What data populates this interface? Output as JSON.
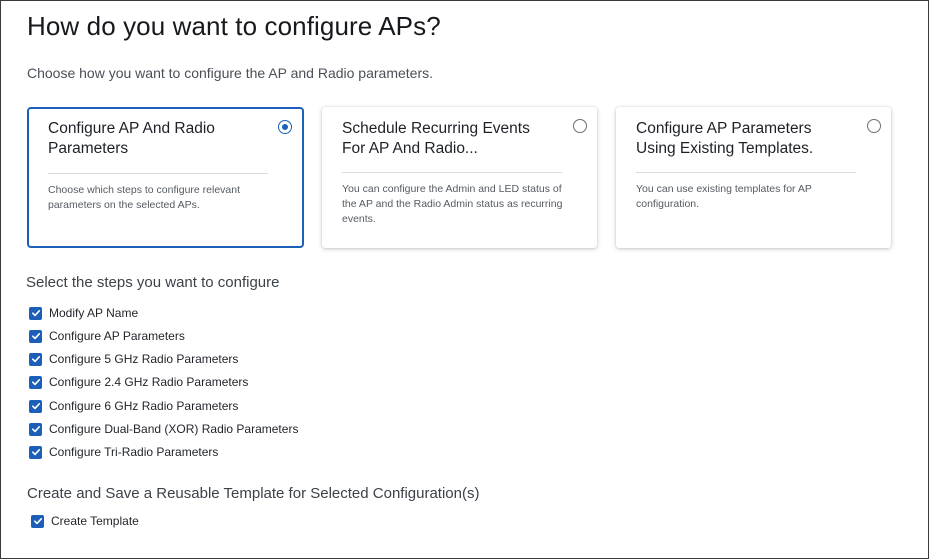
{
  "header": {
    "title": "How do you want to configure APs?",
    "subtitle": "Choose how you want to configure the AP and Radio parameters."
  },
  "options": [
    {
      "title": "Configure AP And Radio Parameters",
      "description": "Choose which steps to configure relevant parameters on the selected APs.",
      "selected": true
    },
    {
      "title": "Schedule Recurring Events For AP And Radio...",
      "description": "You can configure the Admin and LED status of the AP and the Radio Admin status as recurring events.",
      "selected": false
    },
    {
      "title": "Configure AP Parameters Using Existing Templates.",
      "description": "You can use existing templates for AP configuration.",
      "selected": false
    }
  ],
  "steps_section": {
    "title": "Select the steps you want to configure",
    "items": [
      {
        "label": "Modify AP Name",
        "checked": true
      },
      {
        "label": "Configure AP Parameters",
        "checked": true
      },
      {
        "label": "Configure 5 GHz Radio Parameters",
        "checked": true
      },
      {
        "label": "Configure 2.4 GHz Radio Parameters",
        "checked": true
      },
      {
        "label": "Configure 6 GHz Radio Parameters",
        "checked": true
      },
      {
        "label": "Configure Dual-Band (XOR) Radio Parameters",
        "checked": true
      },
      {
        "label": "Configure Tri-Radio Parameters",
        "checked": true
      }
    ]
  },
  "template_section": {
    "title": "Create and Save a Reusable Template for Selected Configuration(s)",
    "items": [
      {
        "label": "Create Template",
        "checked": true
      }
    ]
  },
  "colors": {
    "accent": "#1b5fb8",
    "text": "#1f2329",
    "muted": "#555b63"
  }
}
